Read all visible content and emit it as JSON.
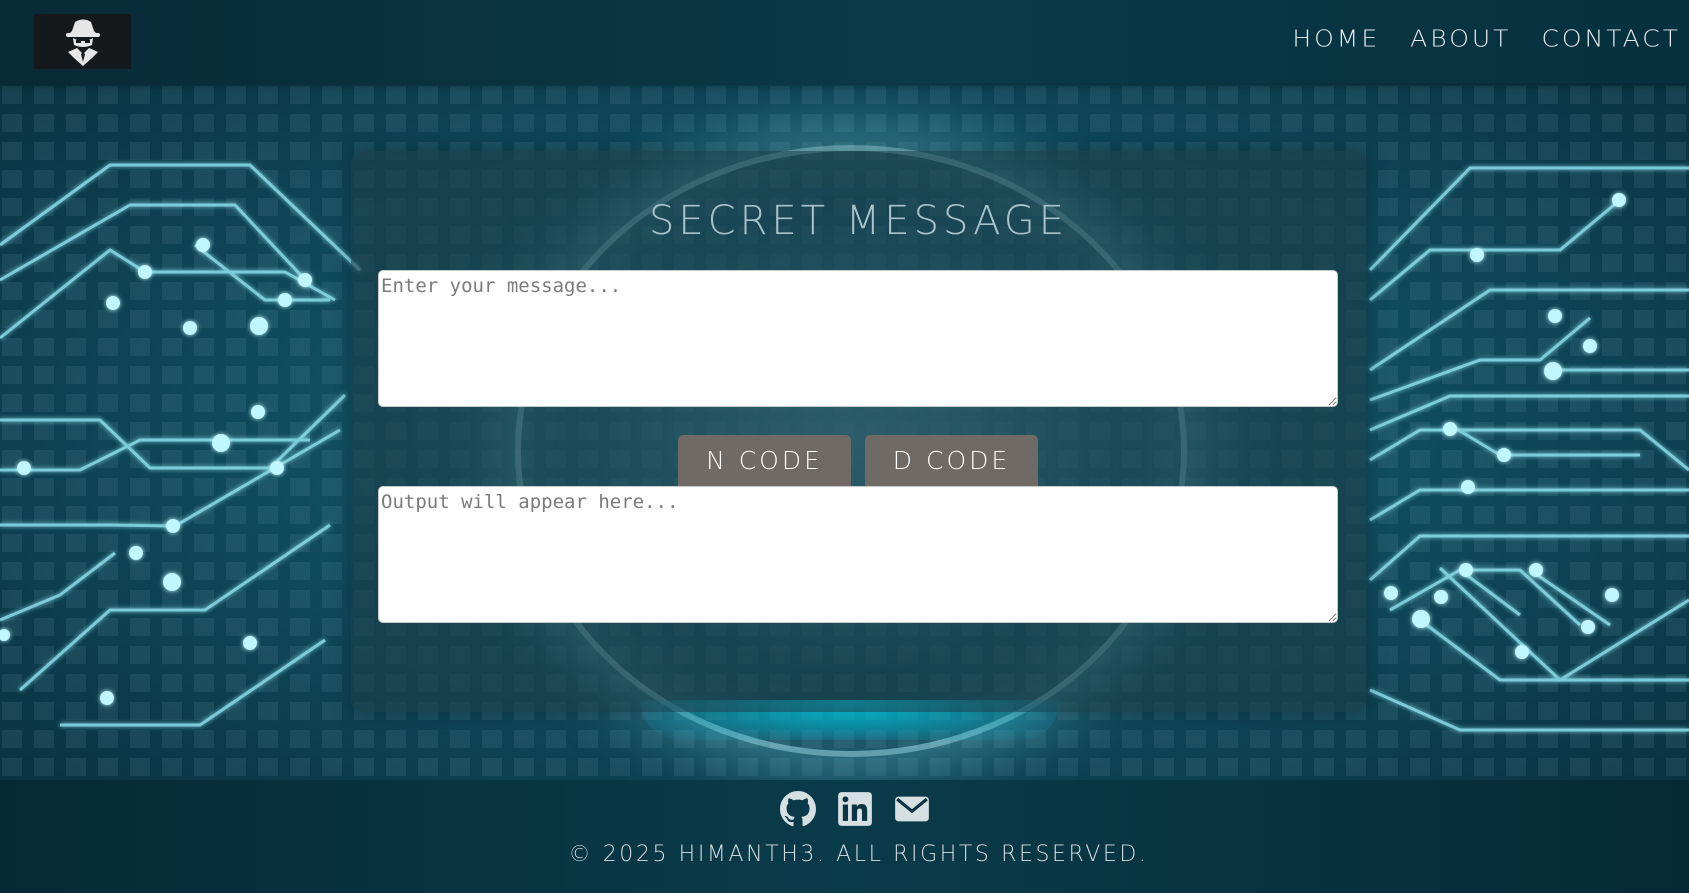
{
  "nav": {
    "logo_icon": "spy-hat-icon",
    "links": [
      {
        "label": "HOME"
      },
      {
        "label": "ABOUT"
      },
      {
        "label": "CONTACT"
      }
    ]
  },
  "card": {
    "title": "SECRET MESSAGE",
    "input_placeholder": "Enter your message...",
    "output_placeholder": "Output will appear here...",
    "encode_label": "N CODE",
    "decode_label": "D CODE"
  },
  "footer": {
    "icons": [
      "github-icon",
      "linkedin-icon",
      "email-icon"
    ],
    "copyright": "© 2025 HIMANTH3. ALL RIGHTS RESERVED."
  },
  "colors": {
    "background": "#0a3443",
    "card": "#1c3e48",
    "button": "#6f6a66",
    "accent_glow": "#00e6ff",
    "text_light": "#d6dfe2"
  }
}
